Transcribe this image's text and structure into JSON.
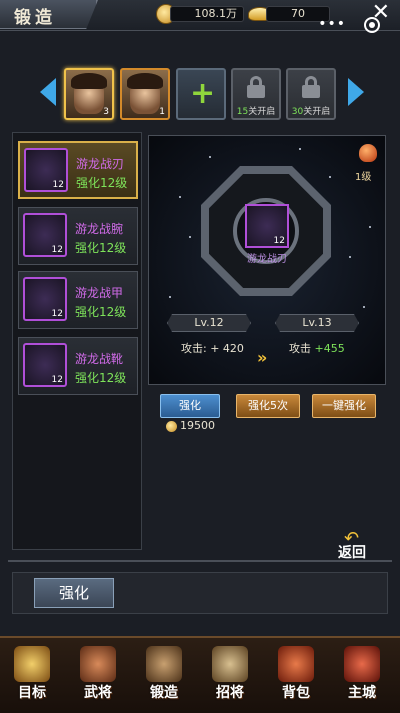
{
  "header": {
    "title": "锻造",
    "silver": "108.1万",
    "gold": "70"
  },
  "heroes": {
    "slots": [
      {
        "type": "hero",
        "count": "3",
        "selected": true
      },
      {
        "type": "hero",
        "count": "1",
        "selected": false
      },
      {
        "type": "add"
      },
      {
        "type": "lock",
        "level": "15",
        "suffix": "关开启"
      },
      {
        "type": "lock",
        "level": "30",
        "suffix": "关开启"
      }
    ]
  },
  "equipment": [
    {
      "name": "游龙战刃",
      "level_text": "强化12级",
      "lv": "12",
      "selected": true
    },
    {
      "name": "游龙战腕",
      "level_text": "强化12级",
      "lv": "12",
      "selected": false
    },
    {
      "name": "游龙战甲",
      "level_text": "强化12级",
      "lv": "12",
      "selected": false
    },
    {
      "name": "游龙战靴",
      "level_text": "强化12级",
      "lv": "12",
      "selected": false
    }
  ],
  "detail": {
    "item_name": "游龙战刃",
    "item_lv": "12",
    "gem_level": "1级",
    "current_lv": "Lv.12",
    "next_lv": "Lv.13",
    "current_attack_label": "攻击:",
    "current_attack_value": "+ 420",
    "next_attack_label": "攻击",
    "next_attack_value": "+455"
  },
  "actions": {
    "strengthen": "强化",
    "strengthen_five": "强化5次",
    "one_click": "一键强化",
    "cost": "19500",
    "return": "返回"
  },
  "tab": {
    "strengthen": "强化"
  },
  "nav": [
    {
      "label": "目标",
      "color": "#c9a24a"
    },
    {
      "label": "武将",
      "color": "#a45a3a"
    },
    {
      "label": "锻造",
      "color": "#8a6a3a"
    },
    {
      "label": "招将",
      "color": "#7a5a3a"
    },
    {
      "label": "背包",
      "color": "#b8462a"
    },
    {
      "label": "主城",
      "color": "#a8322a"
    }
  ],
  "colors": {
    "accent_blue": "#3fa8e8",
    "equip_purple": "#b04fd8",
    "green": "#7ee35a",
    "gold": "#f2c23a"
  }
}
